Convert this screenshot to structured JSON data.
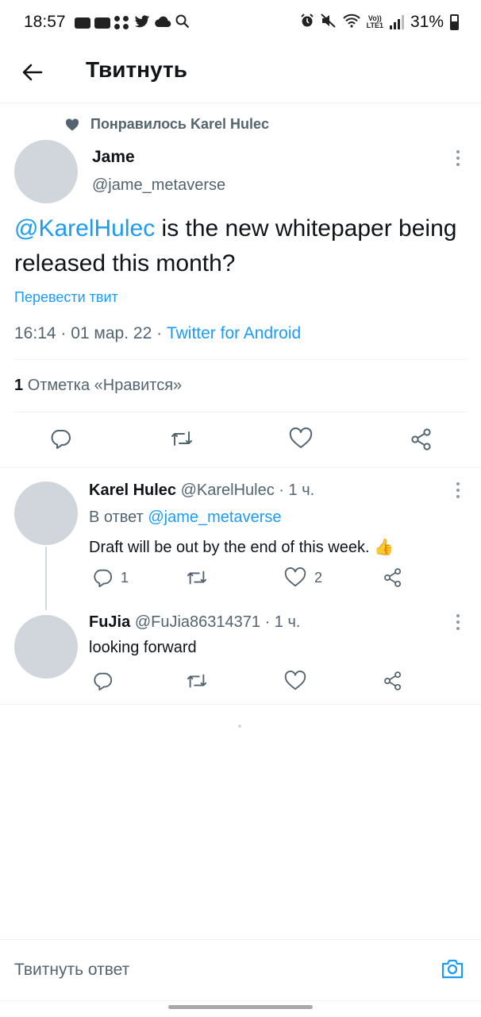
{
  "status_bar": {
    "time": "18:57",
    "battery": "31%",
    "network": "LTE1",
    "volte": "Vo))"
  },
  "header": {
    "title": "Твитнуть"
  },
  "tweet": {
    "social_context": "Понравилось Karel Hulec",
    "author_name": "Jame",
    "author_handle": "@jame_metaverse",
    "mention": "@KarelHulec",
    "text": " is the new whitepaper being released this month?",
    "translate": "Перевести твит",
    "time": "16:14",
    "date": "01 мар. 22",
    "source": "Twitter for Android",
    "separator": " · ",
    "likes_count": "1",
    "likes_label": "Отметка «Нравится»"
  },
  "replies": [
    {
      "name": "Karel Hulec",
      "handle": "@KarelHulec",
      "age": "1 ч.",
      "reply_prefix": "В ответ ",
      "reply_to": "@jame_metaverse",
      "text": "Draft will be out by the end of this week. 👍",
      "reply_count": "1",
      "like_count": "2"
    },
    {
      "name": "FuJia",
      "handle": "@FuJia86314371",
      "age": "1 ч.",
      "text": "looking forward"
    }
  ],
  "composer": {
    "placeholder": "Твитнуть ответ"
  },
  "colors": {
    "accent": "#1d9bf0",
    "secondary_text": "#536471",
    "avatar": "#d0d6db"
  },
  "icons": [
    "back-arrow-icon",
    "heart-icon",
    "more-vertical-icon",
    "reply-icon",
    "retweet-icon",
    "share-icon",
    "camera-icon"
  ]
}
